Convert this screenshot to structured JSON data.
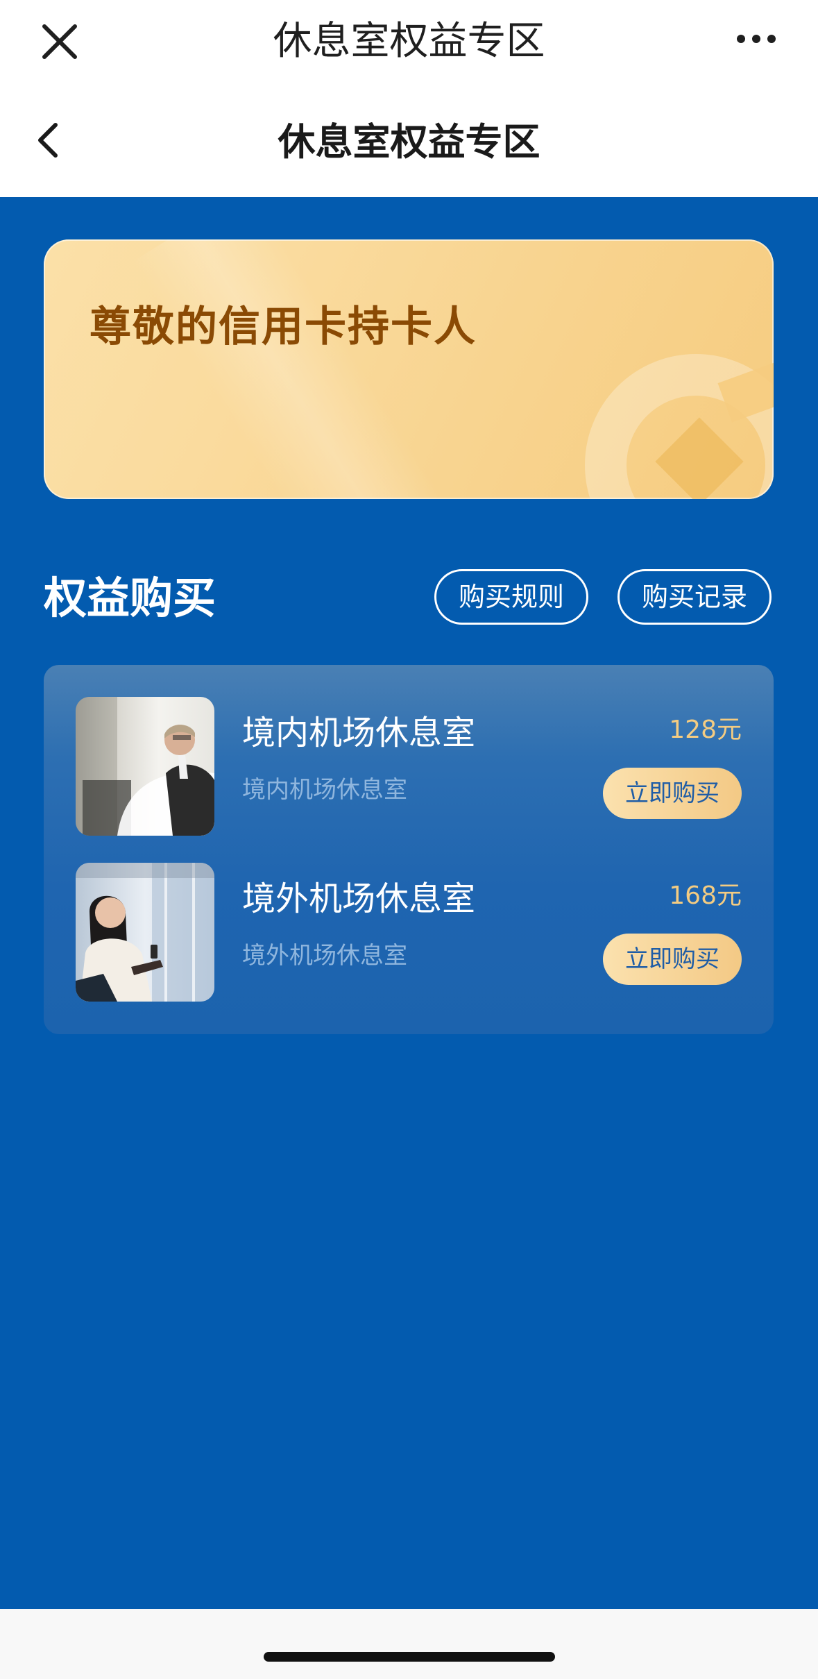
{
  "topbar": {
    "title": "休息室权益专区",
    "close_icon": "close-icon",
    "more_icon": "more-icon"
  },
  "navbar": {
    "title": "休息室权益专区",
    "back_icon": "chevron-left-icon"
  },
  "banner": {
    "greeting": "尊敬的信用卡持卡人"
  },
  "section": {
    "title": "权益购买",
    "rules_label": "购买规则",
    "records_label": "购买记录"
  },
  "products": [
    {
      "name": "境内机场休息室",
      "subtitle": "境内机场休息室",
      "price": "128元",
      "buy_label": "立即购买"
    },
    {
      "name": "境外机场休息室",
      "subtitle": "境外机场休息室",
      "price": "168元",
      "buy_label": "立即购买"
    }
  ],
  "colors": {
    "page_background": "#035BAF",
    "banner_text": "#8A4A04",
    "price": "#F4CC82",
    "buy_button_text": "#1F5DA6"
  }
}
